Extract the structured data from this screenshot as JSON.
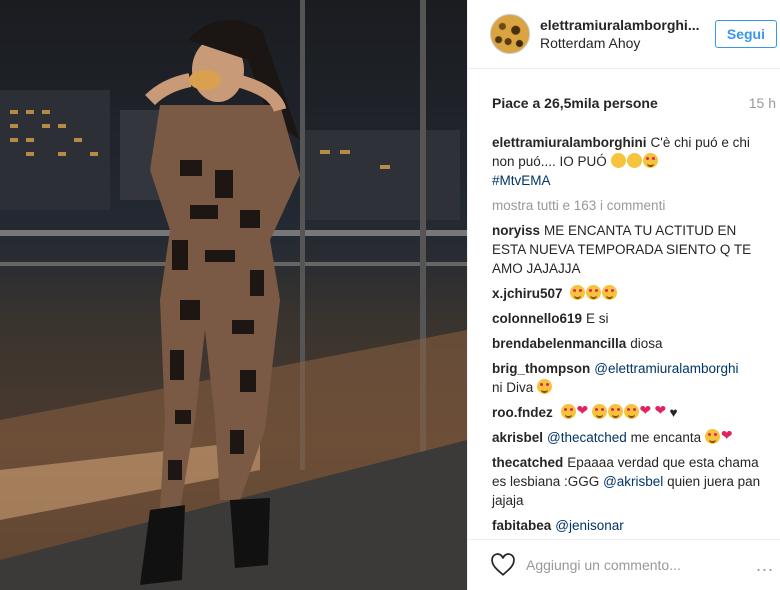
{
  "post": {
    "username": "elettramiuralamborghi...",
    "location": "Rotterdam Ahoy",
    "follow_label": "Segui",
    "likes": "Piace a 26,5mila persone",
    "time": "15 h",
    "caption_user": "elettramiuralamborghini",
    "caption_text": "C'è chi puó e chi non puó.... IO PUÓ",
    "caption_tag": "#MtvEMA",
    "show_all": "mostra tutti e 163 i commenti",
    "add_comment_placeholder": "Aggiungi un commento...",
    "more_glyph": "..."
  },
  "comments": [
    {
      "user": "noryiss",
      "text": "ME ENCANTA TU ACTITUD EN ESTA NUEVA TEMPORADA SIENTO Q TE AMO JAJAJJA"
    },
    {
      "user": "x.jchiru507",
      "text": ""
    },
    {
      "user": "colonnello619",
      "text": "E si"
    },
    {
      "user": "brendabelenmancilla",
      "text": "diosa"
    },
    {
      "user": "brig_thompson",
      "mention": "@elettramiuralamborghi",
      "text": "ni Diva"
    },
    {
      "user": "roo.fndez",
      "text": "♥"
    },
    {
      "user": "akrisbel",
      "mention": "@thecatched",
      "text": "me encanta"
    },
    {
      "user": "thecatched",
      "text": "Epaaaa verdad que esta chama es lesbiana :GGG",
      "mention": "@akrisbel",
      "text2": "quien juera pan jajaja"
    },
    {
      "user": "fabitabea",
      "mention": "@jenisonar",
      "text": ""
    }
  ]
}
